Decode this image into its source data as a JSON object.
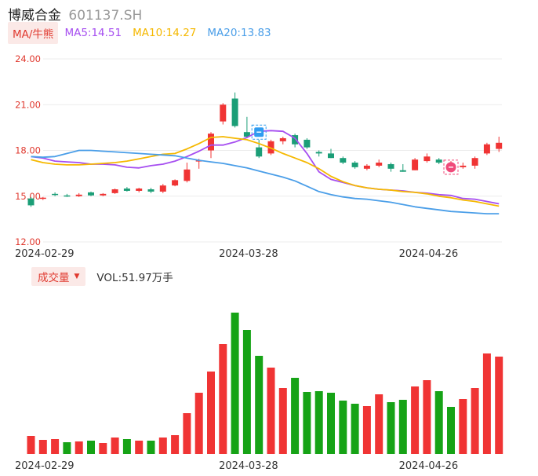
{
  "header": {
    "name": "博威合金",
    "code": "601137.SH"
  },
  "legend": {
    "tag": "MA/牛熊",
    "ma5": "MA5:14.51",
    "ma10": "MA10:14.27",
    "ma20": "MA20:13.83"
  },
  "volume_legend": {
    "tag": "成交量",
    "caret": "▼",
    "value": "VOL:51.97万手"
  },
  "colors": {
    "up": "#f03434",
    "down": "#1b9e77",
    "vol_down": "#16a316",
    "ma5": "#a64ef0",
    "ma10": "#f5b800",
    "ma20": "#4a9ee8",
    "grid": "#ececec",
    "axis_label": "#e0392f",
    "date_label": "#333333"
  },
  "icons": {
    "buy_marker": "buy-signal-icon",
    "sell_marker": "sell-signal-icon"
  },
  "chart_data": [
    {
      "type": "candlestick",
      "title": "",
      "ylim": [
        12,
        24
      ],
      "yticks": [
        "24.00",
        "21.00",
        "18.00",
        "15.00",
        "12.00"
      ],
      "xtick_labels": [
        {
          "index": 1,
          "label": "2024-02-29"
        },
        {
          "index": 18,
          "label": "2024-03-28"
        },
        {
          "index": 33,
          "label": "2024-04-26"
        }
      ],
      "grid": true,
      "candles": [
        {
          "o": 14.85,
          "h": 14.95,
          "l": 14.3,
          "c": 14.4
        },
        {
          "o": 14.85,
          "h": 14.95,
          "l": 14.75,
          "c": 14.9
        },
        {
          "o": 15.15,
          "h": 15.25,
          "l": 15.0,
          "c": 15.1
        },
        {
          "o": 15.05,
          "h": 15.15,
          "l": 14.95,
          "c": 15.0
        },
        {
          "o": 15.0,
          "h": 15.2,
          "l": 14.95,
          "c": 15.1
        },
        {
          "o": 15.25,
          "h": 15.3,
          "l": 15.0,
          "c": 15.05
        },
        {
          "o": 15.05,
          "h": 15.2,
          "l": 15.0,
          "c": 15.15
        },
        {
          "o": 15.2,
          "h": 15.5,
          "l": 15.15,
          "c": 15.45
        },
        {
          "o": 15.5,
          "h": 15.6,
          "l": 15.3,
          "c": 15.35
        },
        {
          "o": 15.35,
          "h": 15.55,
          "l": 15.25,
          "c": 15.5
        },
        {
          "o": 15.45,
          "h": 15.55,
          "l": 15.2,
          "c": 15.3
        },
        {
          "o": 15.3,
          "h": 15.8,
          "l": 15.2,
          "c": 15.7
        },
        {
          "o": 15.7,
          "h": 16.1,
          "l": 15.65,
          "c": 16.05
        },
        {
          "o": 16.0,
          "h": 17.2,
          "l": 15.9,
          "c": 16.75
        },
        {
          "o": 17.3,
          "h": 17.45,
          "l": 16.8,
          "c": 17.35
        },
        {
          "o": 18.0,
          "h": 19.2,
          "l": 17.5,
          "c": 19.1
        },
        {
          "o": 19.9,
          "h": 21.1,
          "l": 19.7,
          "c": 21.0
        },
        {
          "o": 21.4,
          "h": 21.8,
          "l": 19.5,
          "c": 19.6
        },
        {
          "o": 19.2,
          "h": 20.2,
          "l": 18.8,
          "c": 18.9
        },
        {
          "o": 18.2,
          "h": 18.7,
          "l": 17.5,
          "c": 17.6
        },
        {
          "o": 17.8,
          "h": 18.7,
          "l": 17.7,
          "c": 18.6
        },
        {
          "o": 18.6,
          "h": 18.9,
          "l": 18.4,
          "c": 18.8
        },
        {
          "o": 19.0,
          "h": 19.1,
          "l": 18.2,
          "c": 18.4
        },
        {
          "o": 18.7,
          "h": 18.8,
          "l": 18.1,
          "c": 18.2
        },
        {
          "o": 17.9,
          "h": 18.0,
          "l": 17.6,
          "c": 17.8
        },
        {
          "o": 17.8,
          "h": 18.1,
          "l": 17.5,
          "c": 17.5
        },
        {
          "o": 17.5,
          "h": 17.6,
          "l": 17.1,
          "c": 17.2
        },
        {
          "o": 17.2,
          "h": 17.3,
          "l": 16.8,
          "c": 16.9
        },
        {
          "o": 16.8,
          "h": 17.1,
          "l": 16.7,
          "c": 17.0
        },
        {
          "o": 17.0,
          "h": 17.4,
          "l": 16.9,
          "c": 17.2
        },
        {
          "o": 17.1,
          "h": 17.2,
          "l": 16.6,
          "c": 16.8
        },
        {
          "o": 16.7,
          "h": 17.1,
          "l": 16.6,
          "c": 16.6
        },
        {
          "o": 16.7,
          "h": 17.5,
          "l": 16.7,
          "c": 17.4
        },
        {
          "o": 17.3,
          "h": 17.8,
          "l": 17.2,
          "c": 17.6
        },
        {
          "o": 17.4,
          "h": 17.5,
          "l": 17.1,
          "c": 17.2
        },
        {
          "o": 16.8,
          "h": 17.3,
          "l": 16.8,
          "c": 17.1
        },
        {
          "o": 16.9,
          "h": 17.2,
          "l": 16.8,
          "c": 17.0
        },
        {
          "o": 17.0,
          "h": 17.6,
          "l": 16.8,
          "c": 17.5
        },
        {
          "o": 17.8,
          "h": 18.5,
          "l": 17.7,
          "c": 18.4
        },
        {
          "o": 18.1,
          "h": 18.9,
          "l": 17.9,
          "c": 18.5
        }
      ],
      "series": [
        {
          "name": "MA5",
          "color_key": "ma5",
          "values": [
            17.6,
            17.5,
            17.3,
            17.25,
            17.2,
            17.1,
            17.1,
            17.05,
            16.9,
            16.85,
            17.0,
            17.1,
            17.3,
            17.6,
            17.95,
            18.35,
            18.35,
            18.55,
            18.85,
            19.25,
            19.3,
            19.25,
            18.8,
            17.8,
            16.6,
            16.1,
            15.9,
            15.7,
            15.55,
            15.45,
            15.4,
            15.35,
            15.25,
            15.2,
            15.1,
            15.05,
            14.85,
            14.8,
            14.65,
            14.5
          ]
        },
        {
          "name": "MA10",
          "color_key": "ma10",
          "values": [
            17.4,
            17.2,
            17.1,
            17.05,
            17.05,
            17.1,
            17.15,
            17.2,
            17.3,
            17.45,
            17.6,
            17.75,
            17.8,
            18.1,
            18.45,
            18.85,
            18.9,
            18.8,
            18.7,
            18.45,
            18.15,
            17.8,
            17.5,
            17.2,
            16.8,
            16.3,
            15.95,
            15.7,
            15.55,
            15.45,
            15.4,
            15.3,
            15.25,
            15.15,
            15.0,
            14.9,
            14.75,
            14.65,
            14.5,
            14.35
          ]
        },
        {
          "name": "MA20",
          "color_key": "ma20",
          "values": [
            17.6,
            17.55,
            17.6,
            17.8,
            18.0,
            18.0,
            17.95,
            17.9,
            17.85,
            17.8,
            17.75,
            17.7,
            17.65,
            17.5,
            17.35,
            17.25,
            17.15,
            17.0,
            16.85,
            16.65,
            16.45,
            16.25,
            16.0,
            15.65,
            15.3,
            15.1,
            14.95,
            14.85,
            14.8,
            14.7,
            14.6,
            14.45,
            14.3,
            14.2,
            14.1,
            14.0,
            13.95,
            13.9,
            13.85,
            13.85
          ]
        }
      ],
      "markers": [
        {
          "index": 19,
          "value": 19.2,
          "type": "buy"
        },
        {
          "index": 35,
          "value": 16.9,
          "type": "sell"
        }
      ]
    },
    {
      "type": "bar",
      "title": "成交量",
      "values": [
        23,
        18,
        19,
        15,
        16,
        17,
        14,
        21,
        19,
        17,
        17,
        21,
        24,
        52,
        78,
        105,
        140,
        180,
        158,
        125,
        110,
        84,
        97,
        79,
        80,
        78,
        68,
        64,
        61,
        76,
        66,
        69,
        86,
        94,
        80,
        60,
        70,
        84,
        128,
        124
      ],
      "colors": [
        "up",
        "up",
        "up",
        "down",
        "up",
        "down",
        "up",
        "up",
        "down",
        "up",
        "down",
        "up",
        "up",
        "up",
        "up",
        "up",
        "up",
        "down",
        "down",
        "down",
        "up",
        "up",
        "down",
        "down",
        "down",
        "down",
        "down",
        "down",
        "up",
        "up",
        "down",
        "down",
        "up",
        "up",
        "down",
        "down",
        "up",
        "up",
        "up",
        "up"
      ],
      "ylim": [
        0,
        190
      ],
      "xtick_labels": [
        {
          "index": 1,
          "label": "2024-02-29"
        },
        {
          "index": 18,
          "label": "2024-03-28"
        },
        {
          "index": 33,
          "label": "2024-04-26"
        }
      ]
    }
  ]
}
